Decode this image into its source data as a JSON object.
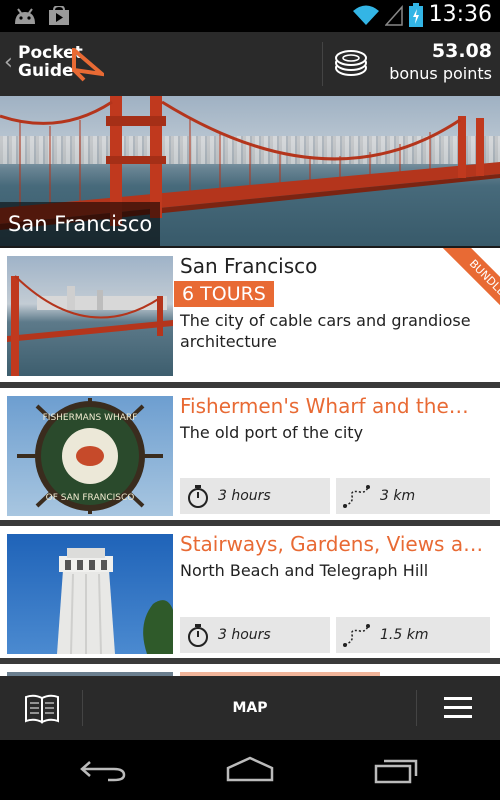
{
  "status": {
    "time": "13:36"
  },
  "app": {
    "logo_line1": "Pocket",
    "logo_line2": "Guide",
    "points": "53.08",
    "points_label": "bonus points"
  },
  "hero": {
    "title": "San Francisco"
  },
  "city_card": {
    "title": "San Francisco",
    "badge": "6 TOURS",
    "ribbon": "BUNDLE",
    "description": "The city of cable cars and grandiose architecture"
  },
  "tours": [
    {
      "title": "Fishermen's Wharf and the…",
      "description": "The old port of the city",
      "duration": "3 hours",
      "distance": "3 km",
      "thumb_text_top": "FISHERMANS WHARF",
      "thumb_text_bottom": "OF SAN FRANCISCO"
    },
    {
      "title": "Stairways, Gardens, Views a…",
      "description": "North Beach and Telegraph Hill",
      "duration": "3 hours",
      "distance": "1.5 km"
    }
  ],
  "bottom_bar": {
    "map_label": "MAP"
  },
  "colors": {
    "accent": "#e86a34",
    "bar": "#2a2a2a"
  }
}
